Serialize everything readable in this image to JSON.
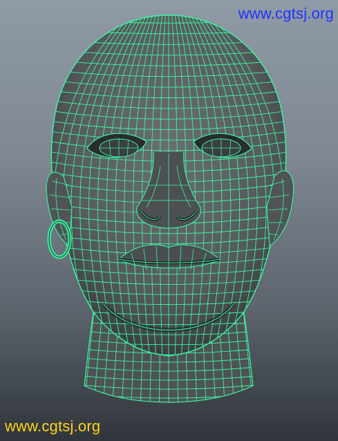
{
  "viewport": {
    "background_top": "#8f9aa6",
    "background_bottom": "#30353b",
    "wireframe_color": "#3cf7a4",
    "shaded_color": "#565a5c"
  },
  "watermark": {
    "top_text": "www.cgtsj.org",
    "top_color": "#1a33ff",
    "bottom_text": "www.cgtsj.org",
    "bottom_color": "#ffd21a"
  },
  "model": {
    "object": "head-mesh",
    "features": [
      "eye-left",
      "eye-right",
      "nose",
      "mouth",
      "ear-left",
      "ear-right",
      "earring",
      "neck"
    ]
  }
}
